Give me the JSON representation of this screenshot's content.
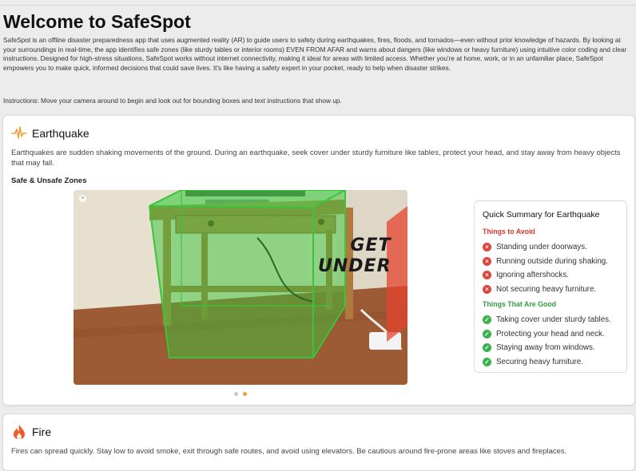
{
  "page": {
    "title": "Welcome to SafeSpot",
    "intro": "SafeSpot is an offline disaster preparedness app that uses augmented reality (AR) to guide users to safety during earthquakes, fires, floods, and tornados—even without prior knowledge of hazards. By looking at your surroundings in real-time, the app identifies safe zones (like sturdy tables or interior rooms) EVEN FROM AFAR and warns about dangers (like windows or heavy furniture) using intuitive color coding and clear instructions. Designed for high-stress situations, SafeSpot works without internet connectivity, making it ideal for areas with limited access. Whether you're at home, work, or in an unfamiliar place, SafeSpot empowers you to make quick, informed decisions that could save lives. It's like having a safety expert in your pocket, ready to help when disaster strikes.",
    "instructions": "Instructions: Move your camera around to begin and look out for bounding boxes and text instructions that show up."
  },
  "earthquake": {
    "icon": "seismic-wave-icon",
    "title": "Earthquake",
    "description": "Earthquakes are sudden shaking movements of the ground. During an earthquake, seek cover under sturdy furniture like tables, protect your head, and stay away from heavy objects that may fall.",
    "zones_label": "Safe & Unsafe Zones",
    "ar_text_line1": "GET",
    "ar_text_line2": "UNDER",
    "carousel_pages": 2,
    "carousel_active": 2,
    "summary": {
      "title": "Quick Summary for Earthquake",
      "avoid_heading": "Things to Avoid",
      "avoid": [
        "Standing under doorways.",
        "Running outside during shaking.",
        "Ignoring aftershocks.",
        "Not securing heavy furniture."
      ],
      "good_heading": "Things That Are Good",
      "good": [
        "Taking cover under sturdy tables.",
        "Protecting your head and neck.",
        "Staying away from windows.",
        "Securing heavy furniture."
      ]
    }
  },
  "fire": {
    "icon": "flame-icon",
    "title": "Fire",
    "description": "Fires can spread quickly. Stay low to avoid smoke, exit through safe routes, and avoid using elevators. Be cautious around fire-prone areas like stoves and fireplaces."
  },
  "colors": {
    "accent": "#e8a33c",
    "safe": "#38b24a",
    "danger": "#e04439"
  }
}
